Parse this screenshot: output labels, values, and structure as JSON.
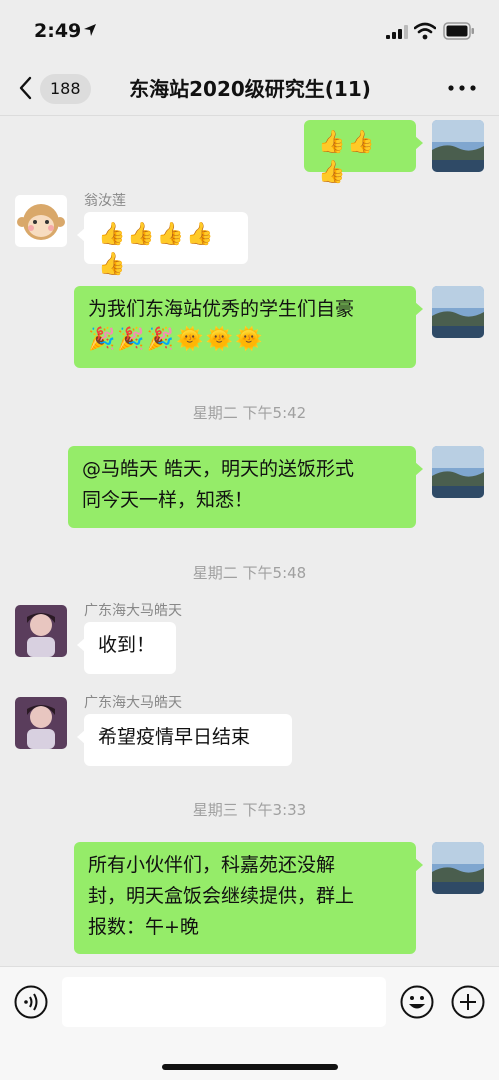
{
  "status_bar": {
    "time": "2:49"
  },
  "header": {
    "back_count": "188",
    "title": "东海站2020级研究生(11)"
  },
  "messages": [
    {
      "type": "me",
      "lines": [
        "👍👍👍"
      ]
    },
    {
      "type": "other",
      "sender": "翁汝莲",
      "lines": [
        "👍👍👍👍👍"
      ]
    },
    {
      "type": "me",
      "lines": [
        "为我们东海站优秀的学生们自豪",
        "🎉🎉🎉🌞🌞🌞"
      ]
    },
    {
      "type": "timestamp",
      "text": "星期二 下午5:42"
    },
    {
      "type": "me",
      "lines": [
        "@马皓天 皓天，明天的送饭形式",
        "同今天一样，知悉！"
      ]
    },
    {
      "type": "timestamp",
      "text": "星期二 下午5:48"
    },
    {
      "type": "other",
      "sender": "广东海大马皓天",
      "lines": [
        "收到！"
      ]
    },
    {
      "type": "other",
      "sender": "广东海大马皓天",
      "lines": [
        "希望疫情早日结束"
      ]
    },
    {
      "type": "timestamp",
      "text": "星期三 下午3:33"
    },
    {
      "type": "me",
      "lines": [
        "所有小伙伴们，科嘉苑还没解",
        "封，明天盒饭会继续提供，群上",
        "报数：午+晚"
      ]
    }
  ],
  "input": {
    "value": "",
    "placeholder": ""
  },
  "icons": {
    "back": "chevron-left-icon",
    "more": "more-dots-icon",
    "voice": "voice-icon",
    "emoji": "emoji-icon",
    "plus": "plus-icon"
  },
  "colors": {
    "my_bubble": "#95ec69",
    "other_bubble": "#ffffff",
    "background": "#ededed"
  }
}
